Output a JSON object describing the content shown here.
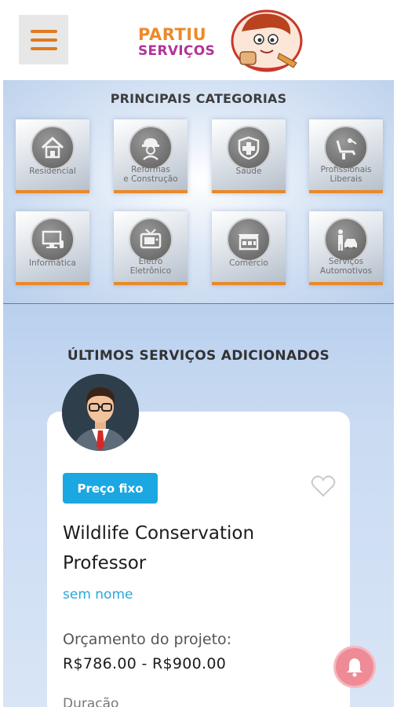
{
  "header": {
    "menu_icon": "hamburger-menu-icon",
    "logo_line1": "PARTIU",
    "logo_line2": "SERVIÇOS",
    "brand_orange": "#ec8a2b",
    "brand_purple": "#b2339a"
  },
  "categories": {
    "title": "PRINCIPAIS CATEGORIAS",
    "items": [
      {
        "label": "Residencial",
        "icon": "house-icon"
      },
      {
        "label": "Reformas\ne Construção",
        "icon": "construction-worker-icon"
      },
      {
        "label": "Saúde",
        "icon": "health-cross-24h-icon"
      },
      {
        "label": "Profissionais\nLiberais",
        "icon": "dentist-chair-icon"
      },
      {
        "label": "Informática",
        "icon": "computer-icon"
      },
      {
        "label": "Eletro\nEletrônico",
        "icon": "television-icon"
      },
      {
        "label": "Comércio",
        "icon": "storefront-icon"
      },
      {
        "label": "Serviços\nAutomotivos",
        "icon": "car-service-icon"
      }
    ]
  },
  "latest": {
    "title": "ÚLTIMOS SERVIÇOS ADICIONADOS",
    "card": {
      "avatar_icon": "businessman-avatar-icon",
      "badge": "Preço fixo",
      "favorite_icon": "heart-outline-icon",
      "title": "Wildlife Conservation Professor",
      "company": "sem nome",
      "budget_label": "Orçamento do projeto:",
      "budget_value": "R$786.00 - R$900.00",
      "next_label": "Duração"
    }
  },
  "notification_icon": "bell-icon",
  "accent": "#1aa7e2"
}
